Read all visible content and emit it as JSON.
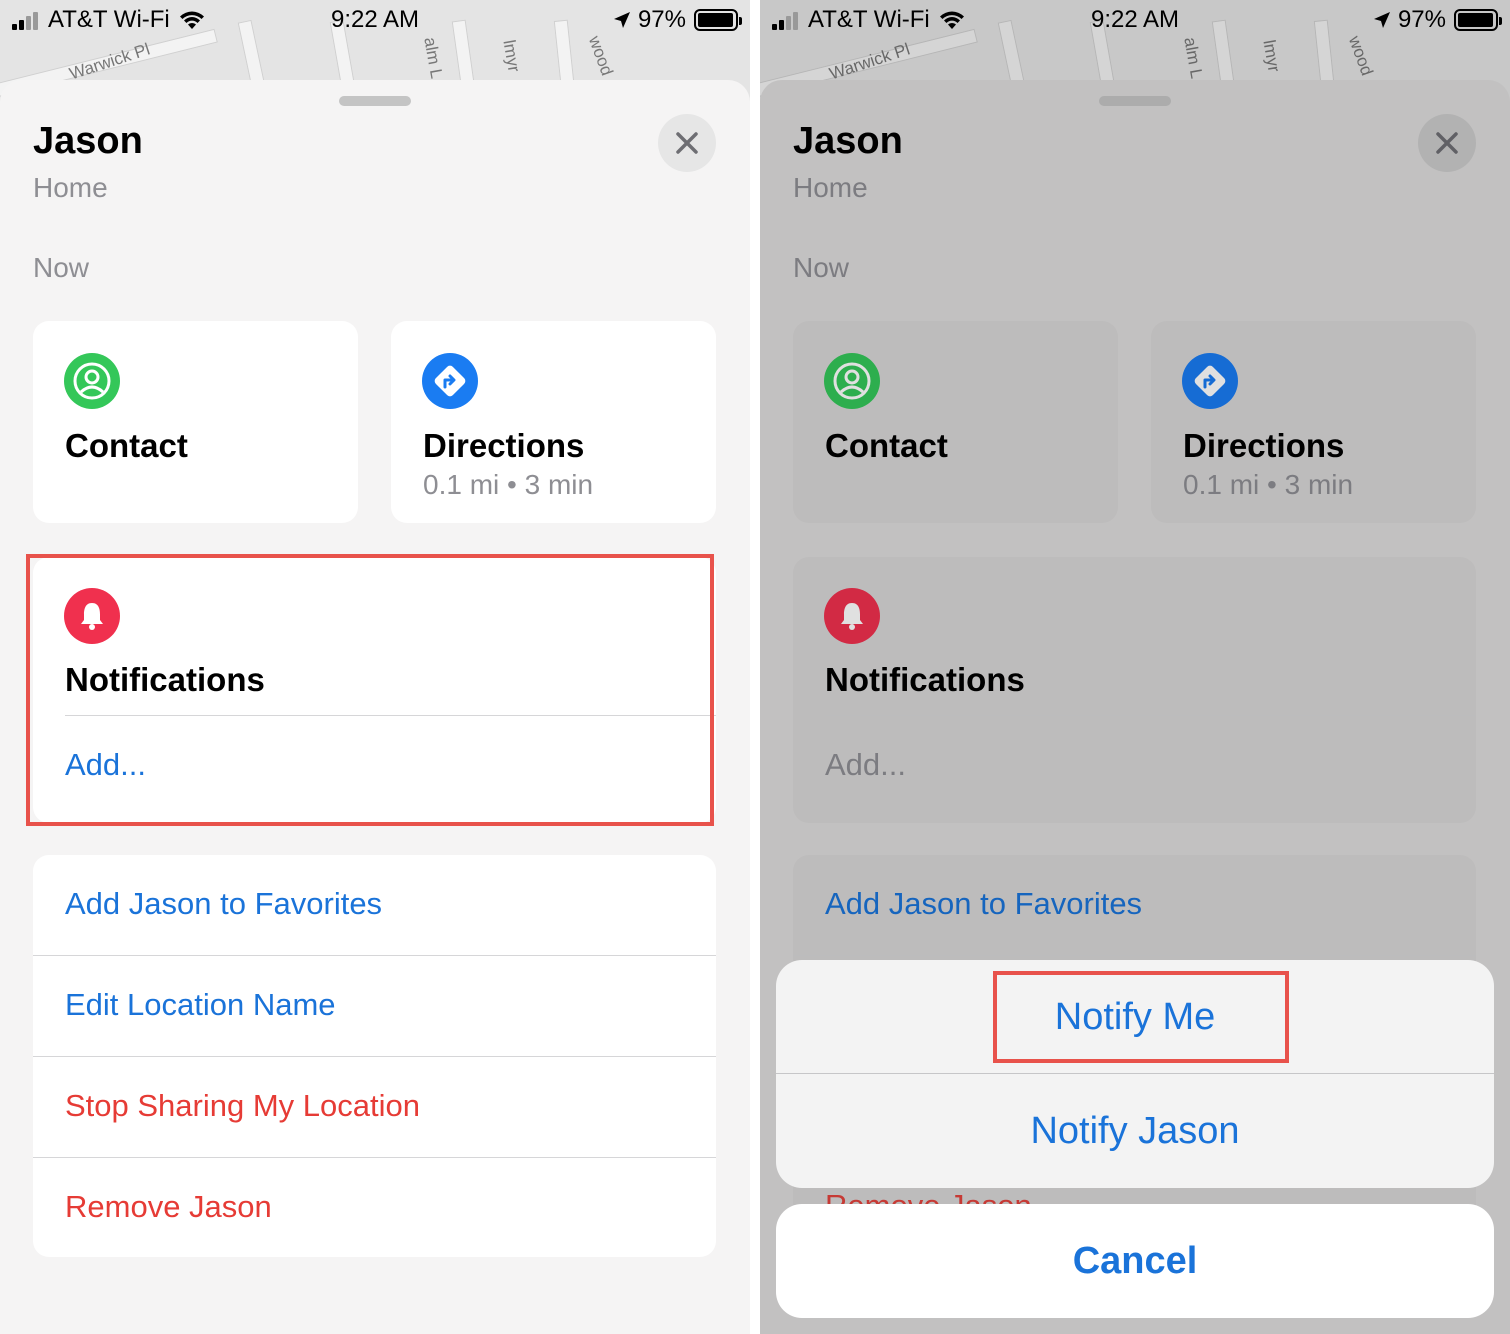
{
  "status_bar": {
    "carrier": "AT&T Wi-Fi",
    "time": "9:22 AM",
    "battery": "97%",
    "battery_level": 0.97
  },
  "map": {
    "street_labels": [
      "Warwick Pl",
      "alm L",
      "lmyr",
      "wood"
    ]
  },
  "person": {
    "name": "Jason",
    "location": "Home",
    "updated": "Now"
  },
  "cards": {
    "contact_label": "Contact",
    "directions_label": "Directions",
    "directions_info": "0.1 mi • 3 min",
    "notifications_label": "Notifications",
    "notifications_add": "Add..."
  },
  "actions": [
    {
      "label": "Add Jason to Favorites",
      "style": "blue"
    },
    {
      "label": "Edit Location Name",
      "style": "blue"
    },
    {
      "label": "Stop Sharing My Location",
      "style": "red"
    },
    {
      "label": "Remove Jason",
      "style": "red"
    }
  ],
  "action_sheet": {
    "option_1": "Notify Me",
    "option_2": "Notify Jason",
    "cancel": "Cancel"
  },
  "colors": {
    "accent_blue": "#1a73d9",
    "destructive_red": "#e63b35",
    "highlight": "#e8524b",
    "contact_green": "#34c759",
    "directions_blue": "#1a7cf2",
    "notification_pink": "#f0304e"
  },
  "icons": {
    "close": "close-icon",
    "contact": "person-circle-icon",
    "directions": "directions-arrow-icon",
    "notifications": "bell-icon"
  }
}
